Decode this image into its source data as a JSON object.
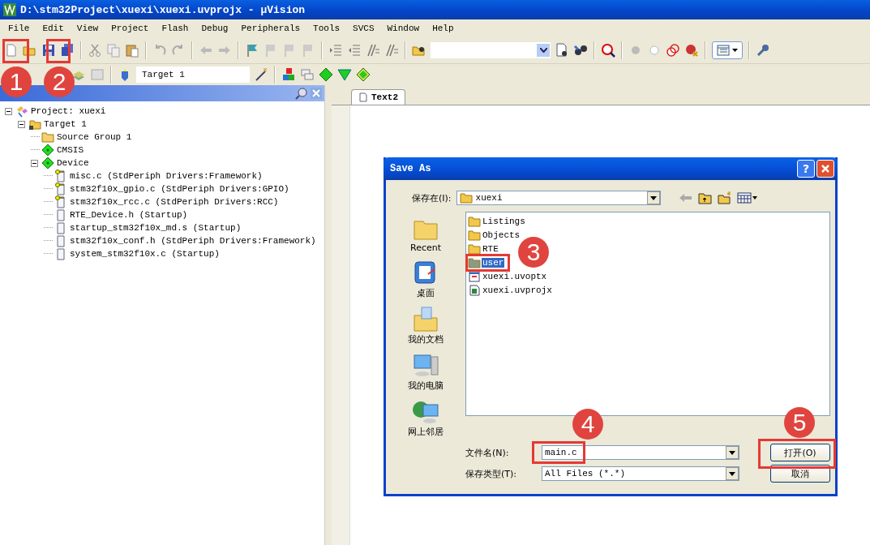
{
  "window": {
    "title": "D:\\stm32Project\\xuexi\\xuexi.uvprojx - µVision"
  },
  "menu": [
    "File",
    "Edit",
    "View",
    "Project",
    "Flash",
    "Debug",
    "Peripherals",
    "Tools",
    "SVCS",
    "Window",
    "Help"
  ],
  "build_toolbar": {
    "target": "Target 1"
  },
  "project_panel": {
    "tree": [
      {
        "label": "Project: xuexi",
        "kind": "project",
        "expanded": true,
        "children": [
          {
            "label": "Target 1",
            "kind": "target",
            "expanded": true,
            "children": [
              {
                "label": "Source Group 1",
                "kind": "group"
              },
              {
                "label": "CMSIS",
                "kind": "component"
              },
              {
                "label": "Device",
                "kind": "component",
                "expanded": true,
                "children": [
                  {
                    "label": "misc.c (StdPeriph Drivers:Framework)",
                    "kind": "locked-file"
                  },
                  {
                    "label": "stm32f10x_gpio.c (StdPeriph Drivers:GPIO)",
                    "kind": "locked-file"
                  },
                  {
                    "label": "stm32f10x_rcc.c (StdPeriph Drivers:RCC)",
                    "kind": "locked-file"
                  },
                  {
                    "label": "RTE_Device.h (Startup)",
                    "kind": "file"
                  },
                  {
                    "label": "startup_stm32f10x_md.s (Startup)",
                    "kind": "file"
                  },
                  {
                    "label": "stm32f10x_conf.h (StdPeriph Drivers:Framework)",
                    "kind": "file"
                  },
                  {
                    "label": "system_stm32f10x.c (Startup)",
                    "kind": "file"
                  }
                ]
              }
            ]
          }
        ]
      }
    ]
  },
  "editor": {
    "tabs": [
      {
        "label": "Text2",
        "selected": true
      }
    ]
  },
  "dialog": {
    "title": "Save As",
    "help_button": "?",
    "look_in_label": "保存在(I):",
    "look_in": "xuexi",
    "places": [
      {
        "label": "Recent",
        "kind": "recent"
      },
      {
        "label": "桌面",
        "kind": "desktop"
      },
      {
        "label": "我的文档",
        "kind": "documents"
      },
      {
        "label": "我的电脑",
        "kind": "computer"
      },
      {
        "label": "网上邻居",
        "kind": "network"
      }
    ],
    "files": [
      {
        "name": "Listings",
        "kind": "folder",
        "selected": false
      },
      {
        "name": "Objects",
        "kind": "folder",
        "selected": false
      },
      {
        "name": "RTE",
        "kind": "folder",
        "selected": false
      },
      {
        "name": "user",
        "kind": "folder",
        "selected": true
      },
      {
        "name": "xuexi.uvoptx",
        "kind": "options",
        "selected": false
      },
      {
        "name": "xuexi.uvprojx",
        "kind": "project",
        "selected": false
      }
    ],
    "filename_label": "文件名(N):",
    "filename": "main.c",
    "filetype_label": "保存类型(T):",
    "filetype": "All Files (*.*)",
    "buttons": [
      "打开(O)",
      "取消"
    ]
  },
  "annotations": [
    {
      "label": "1"
    },
    {
      "label": "2"
    },
    {
      "label": "3"
    },
    {
      "label": "4"
    },
    {
      "label": "5"
    }
  ]
}
